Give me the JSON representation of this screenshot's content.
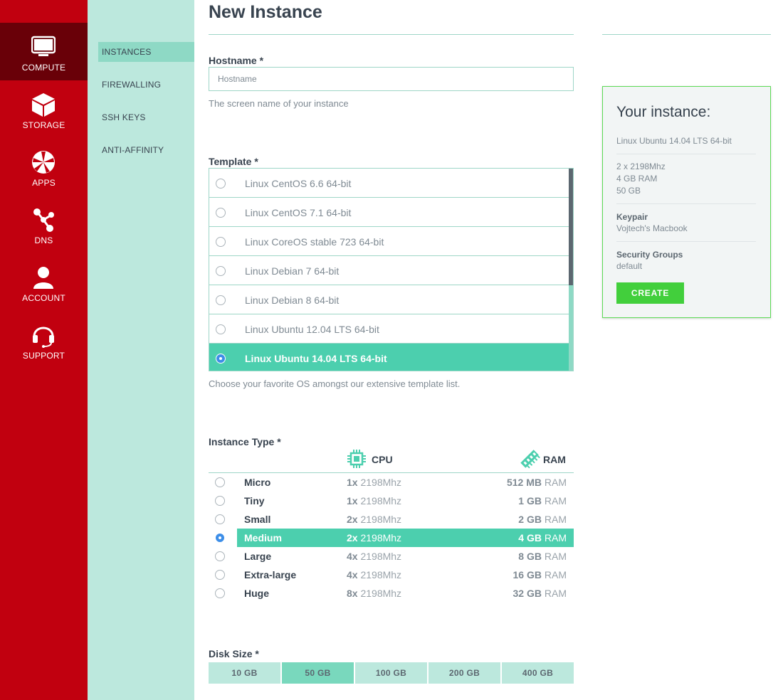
{
  "nav": {
    "items": [
      {
        "label": "COMPUTE",
        "icon": "monitor-icon"
      },
      {
        "label": "STORAGE",
        "icon": "box-icon"
      },
      {
        "label": "APPS",
        "icon": "apps-icon"
      },
      {
        "label": "DNS",
        "icon": "share-icon"
      },
      {
        "label": "ACCOUNT",
        "icon": "user-icon"
      },
      {
        "label": "SUPPORT",
        "icon": "headset-icon"
      }
    ]
  },
  "subnav": {
    "items": [
      {
        "label": "INSTANCES"
      },
      {
        "label": "FIREWALLING"
      },
      {
        "label": "SSH KEYS"
      },
      {
        "label": "ANTI-AFFINITY"
      }
    ]
  },
  "page": {
    "title": "New Instance"
  },
  "hostname": {
    "label": "Hostname *",
    "placeholder": "Hostname",
    "help": "The screen name of your instance"
  },
  "template": {
    "label": "Template *",
    "options": [
      "Linux CentOS 6.6 64-bit",
      "Linux CentOS 7.1 64-bit",
      "Linux CoreOS stable 723 64-bit",
      "Linux Debian 7 64-bit",
      "Linux Debian 8 64-bit",
      "Linux Ubuntu 12.04 LTS 64-bit",
      "Linux Ubuntu 14.04 LTS 64-bit"
    ],
    "selected": "Linux Ubuntu 14.04 LTS 64-bit",
    "help": "Choose your favorite OS amongst our extensive template list."
  },
  "instance_type": {
    "label": "Instance Type *",
    "cpu_header": "CPU",
    "ram_header": "RAM",
    "rows": [
      {
        "name": "Micro",
        "cores": "1x",
        "freq": "2198Mhz",
        "ram": "512 MB",
        "ram_unit": "RAM"
      },
      {
        "name": "Tiny",
        "cores": "1x",
        "freq": "2198Mhz",
        "ram": "1 GB",
        "ram_unit": "RAM"
      },
      {
        "name": "Small",
        "cores": "2x",
        "freq": "2198Mhz",
        "ram": "2 GB",
        "ram_unit": "RAM"
      },
      {
        "name": "Medium",
        "cores": "2x",
        "freq": "2198Mhz",
        "ram": "4 GB",
        "ram_unit": "RAM"
      },
      {
        "name": "Large",
        "cores": "4x",
        "freq": "2198Mhz",
        "ram": "8 GB",
        "ram_unit": "RAM"
      },
      {
        "name": "Extra-large",
        "cores": "4x",
        "freq": "2198Mhz",
        "ram": "16 GB",
        "ram_unit": "RAM"
      },
      {
        "name": "Huge",
        "cores": "8x",
        "freq": "2198Mhz",
        "ram": "32 GB",
        "ram_unit": "RAM"
      }
    ],
    "selected": "Medium"
  },
  "disk": {
    "label": "Disk Size *",
    "options": [
      "10 GB",
      "50 GB",
      "100 GB",
      "200 GB",
      "400 GB"
    ],
    "selected": "50 GB"
  },
  "summary": {
    "heading": "Your instance:",
    "template": "Linux Ubuntu 14.04 LTS 64-bit",
    "cpu": "2 x 2198Mhz",
    "ram": "4 GB RAM",
    "disk": "50 GB",
    "keypair_label": "Keypair",
    "keypair": "Vojtech's Macbook",
    "security_label": "Security Groups",
    "security": "default",
    "create_label": "CREATE"
  },
  "colors": {
    "nav_red": "#c1000f",
    "nav_active": "#690008",
    "subnav_bg": "#bce8dd",
    "accent_green": "#4ccfae",
    "create_green": "#42cf3c"
  }
}
